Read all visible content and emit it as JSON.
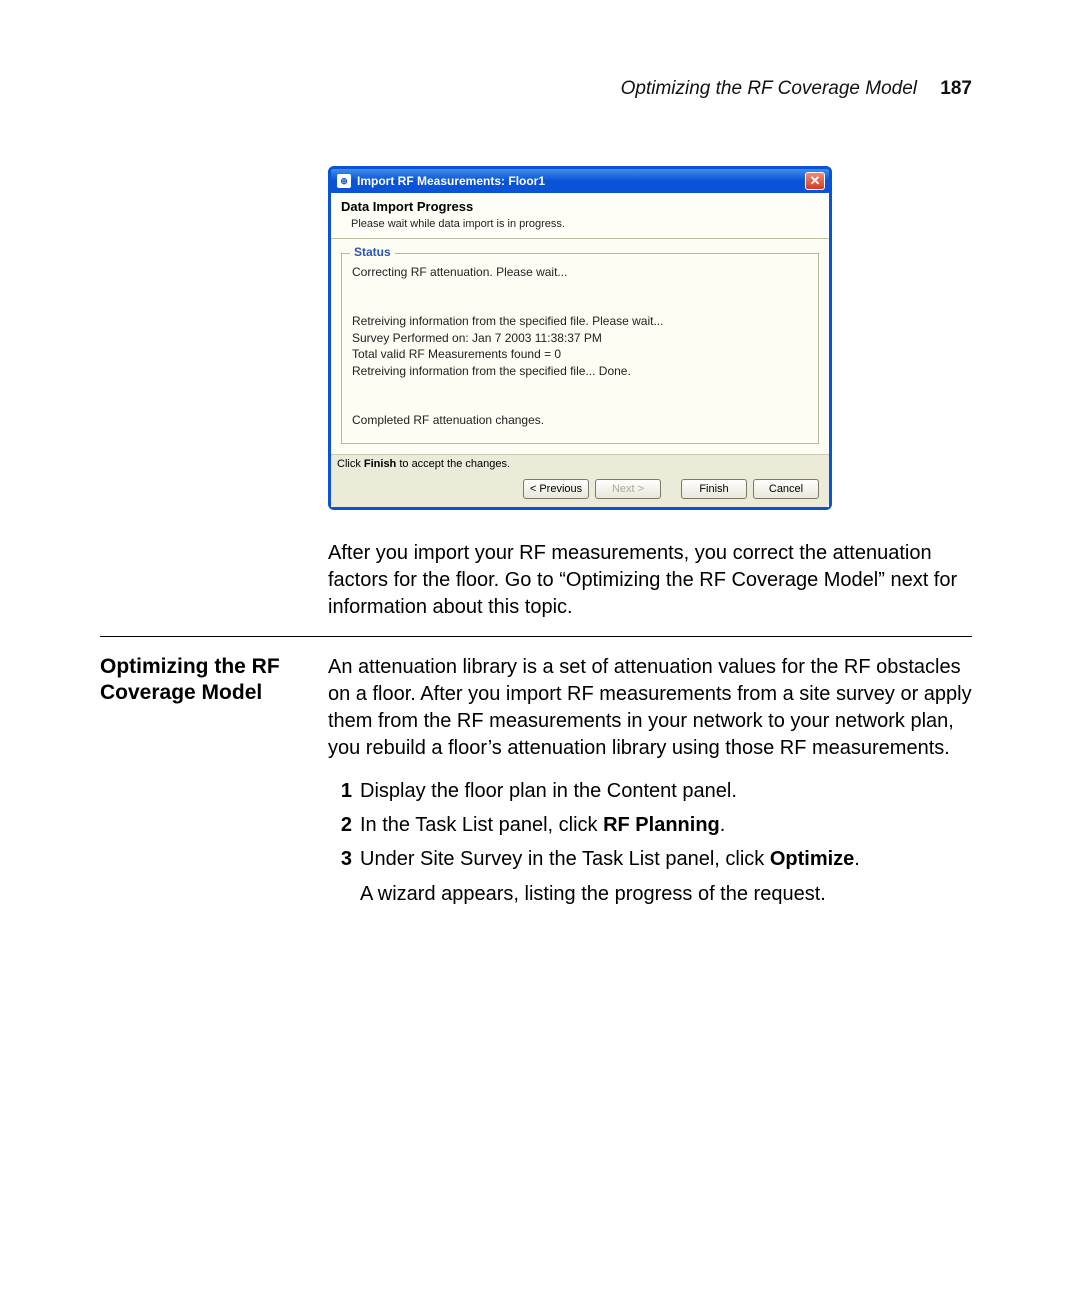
{
  "header": {
    "title": "Optimizing the RF Coverage Model",
    "page_number": "187"
  },
  "dialog": {
    "window_title": "Import RF Measurements: Floor1",
    "heading": "Data Import Progress",
    "subheading": "Please wait while data import is in progress.",
    "status_legend": "Status",
    "status_lines": {
      "l1": "Correcting RF attenuation. Please wait...",
      "l2": "Retreiving information from the specified file. Please wait...",
      "l3": "Survey Performed on: Jan 7 2003 11:38:37 PM",
      "l4": "Total valid RF Measurements found = 0",
      "l5": "Retreiving information from the specified file... Done.",
      "l6": "Completed RF attenuation changes."
    },
    "footer_hint_pre": "Click ",
    "footer_hint_bold": "Finish",
    "footer_hint_post": " to accept the changes.",
    "buttons": {
      "previous": "< Previous",
      "next": "Next >",
      "finish": "Finish",
      "cancel": "Cancel"
    }
  },
  "body": {
    "para1": "After you import your RF measurements, you correct the attenuation factors for the floor. Go to “Optimizing the RF Coverage Model” next for information about this topic.",
    "section_title": "Optimizing the RF Coverage Model",
    "section_body": "An attenuation library is a set of attenuation values for the RF obstacles on a floor. After you import RF measurements from a site survey or apply them from the RF measurements in your network to your network plan, you rebuild a floor’s attenuation library using those RF measurements.",
    "steps": [
      {
        "n": "1",
        "text_pre": "Display the floor plan in the Content panel.",
        "bold": "",
        "text_post": ""
      },
      {
        "n": "2",
        "text_pre": "In the Task List panel, click ",
        "bold": "RF Planning",
        "text_post": "."
      },
      {
        "n": "3",
        "text_pre": "Under Site Survey in the Task List panel, click ",
        "bold": "Optimize",
        "text_post": "."
      }
    ],
    "post_step": "A wizard appears, listing the progress of the request."
  }
}
